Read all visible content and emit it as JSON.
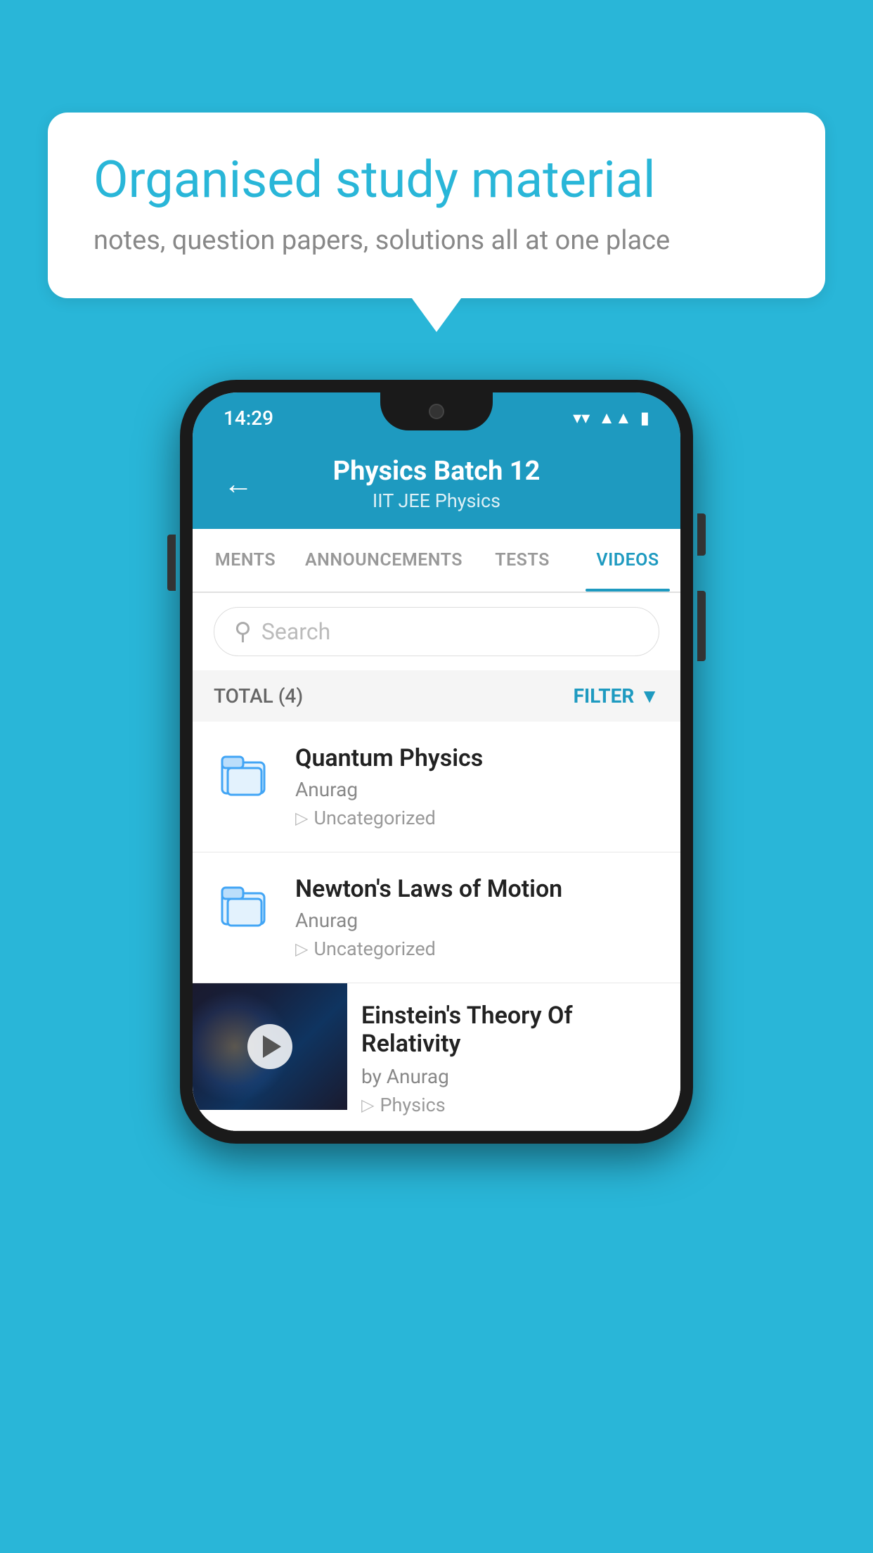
{
  "background_color": "#29b6d8",
  "bubble": {
    "title": "Organised study material",
    "subtitle": "notes, question papers, solutions all at one place"
  },
  "phone": {
    "status_bar": {
      "time": "14:29"
    },
    "app_bar": {
      "title": "Physics Batch 12",
      "subtitle": "IIT JEE   Physics",
      "back_label": "←"
    },
    "tabs": [
      {
        "label": "MENTS",
        "active": false
      },
      {
        "label": "ANNOUNCEMENTS",
        "active": false
      },
      {
        "label": "TESTS",
        "active": false
      },
      {
        "label": "VIDEOS",
        "active": true
      }
    ],
    "search": {
      "placeholder": "Search"
    },
    "filter_row": {
      "total_label": "TOTAL (4)",
      "filter_label": "FILTER"
    },
    "list_items": [
      {
        "title": "Quantum Physics",
        "author": "Anurag",
        "tag": "Uncategorized",
        "type": "folder"
      },
      {
        "title": "Newton's Laws of Motion",
        "author": "Anurag",
        "tag": "Uncategorized",
        "type": "folder"
      },
      {
        "title": "Einstein's Theory Of Relativity",
        "author": "by Anurag",
        "tag": "Physics",
        "type": "video"
      }
    ]
  }
}
